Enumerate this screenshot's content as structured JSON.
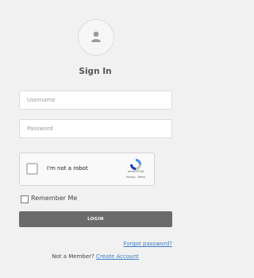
{
  "header": {
    "avatar_icon": "user-icon",
    "title": "Sign In"
  },
  "form": {
    "username_placeholder": "Username",
    "password_placeholder": "Password"
  },
  "captcha": {
    "label": "I'm not a robot",
    "brand": "reCAPTCHA",
    "terms": "Privacy - Terms",
    "logo_icon": "recaptcha-logo-icon"
  },
  "remember": {
    "label": "Remember Me",
    "checked": false
  },
  "actions": {
    "login_label": "LOGIN",
    "forgot_label": "Forgot password?",
    "member_prompt": "Not a Member?",
    "create_account_label": "Create Account"
  },
  "colors": {
    "background": "#f1f1f1",
    "button": "#6b6b6b",
    "link": "#3d7ec3"
  }
}
